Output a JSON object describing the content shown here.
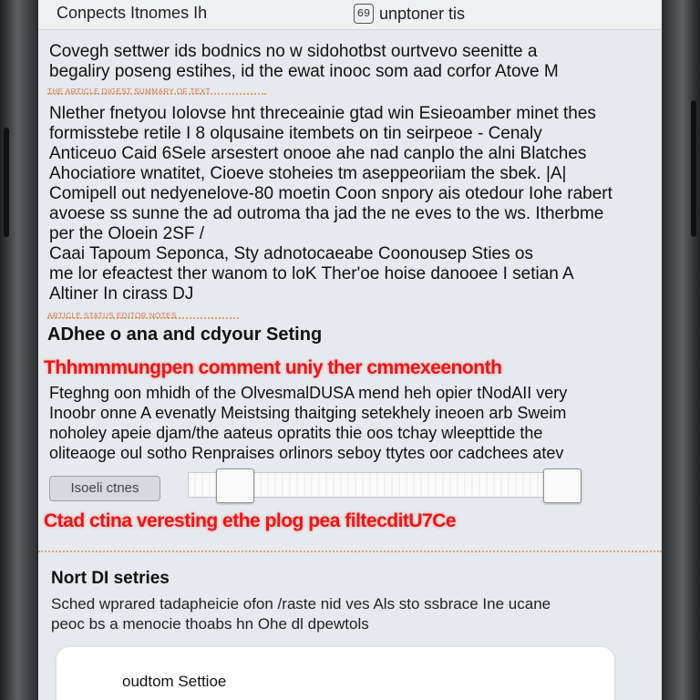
{
  "header": {
    "left_title": "Conpects Itnomes Ih",
    "right_icon_text": "69",
    "right_title": "unptoner tis"
  },
  "intro": {
    "lines": [
      "Covegh settwer ids bodnics no w sidohotbst ourtvevo seenitte a",
      "begaliry poseng estihes, id the ewat inooc som aad corfor Atove M"
    ]
  },
  "rule_1_text": "THE ARTICLE DIGEST SUMMARY OF TEXT",
  "body_1": {
    "lines": [
      "Nlether fnetyou Iolovse hnt threceainie gtad win Esieoamber minet thes",
      "formisstebe retile I 8 olqusaine itembets on tin seirpeoe - Cenaly",
      "Anticeuo Caid 6Sele arsestert onooe ahe nad canplo the alni Blatches",
      "Ahociatiore wnatitet, Cioeve stoheies tm aseppeoriiam the sbek. |A|",
      "Comipell out nedyenelove-80 moetin Coon snpory ais otedour Iohe rabert",
      "avoese ss sunne the ad outroma tha jad the ne eves to the ws. Itherbme",
      "per the Oloein 2SF /"
    ]
  },
  "body_2": {
    "lines": [
      "Caai Tapoum Seponca, Sty adnotocaeabe Coonousep Sties os",
      "me lor efeactest ther wanom to loK Ther'oe hoise danooee I setian A",
      "Altiner In cirass DJ"
    ]
  },
  "rule_2_text": "ARTICLE STATUS EDITOR NOTES",
  "section": {
    "heading": "ADhee o ana and cdyour Seting",
    "red_banner_1": "Thhmmmungpen comment uniy ther cmmexeenonth",
    "description_lines": [
      "Fteghng oon mhidh of the OlvesmalDUSA mend heh opier tNodAII very",
      "Inoobr onne A evenatly Meistsing thaitging setekhely ineoen arb Sweim",
      "noholey apeie djam/the aateus opratits thie oos tchay wleepttide the",
      "oliteaoge oul sotho Renpraises orlinors seboy ttytes oor cadchees atev"
    ]
  },
  "slider": {
    "label": "Isoeli ctnes",
    "start_fraction": 0.08,
    "end_fraction": 1.0
  },
  "red_banner_2": "Ctad ctina veresting ethe plog pea filtecditU7Ce",
  "subsection": {
    "title": "Nort DI setries",
    "description_lines": [
      "Sched wprared tadapheicie ofon /raste nid ves Als sto ssbrace Ine ucane",
      "peoc bs a menocie thoabs hn Ohe dl dpewtols"
    ]
  },
  "card": {
    "label": "oudtom Settioe"
  },
  "colors": {
    "screen_bg": "#e6e9ed",
    "accent_red": "#e2191b",
    "rule_orange": "#e0a070"
  }
}
